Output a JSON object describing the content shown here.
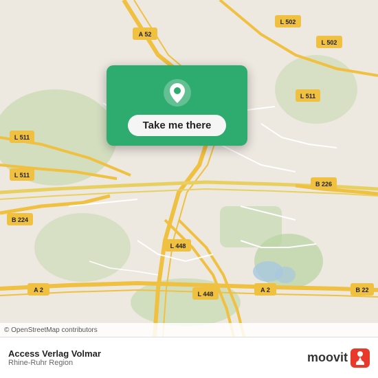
{
  "map": {
    "attribution": "© OpenStreetMap contributors",
    "background_color": "#e8e0d8",
    "road_labels": [
      "A 52",
      "L 502",
      "L 511",
      "L 511",
      "B 224",
      "B 226",
      "L 448",
      "L 448",
      "A 2",
      "A 2",
      "B 22"
    ],
    "center_lat": 51.48,
    "center_lng": 7.0
  },
  "location_card": {
    "button_label": "Take me there",
    "bg_color": "#2eab6e"
  },
  "attribution": {
    "text": "© OpenStreetMap contributors"
  },
  "bottom_bar": {
    "place_name": "Access Verlag Volmar",
    "place_region": "Rhine-Ruhr Region",
    "app_name": "moovit"
  }
}
